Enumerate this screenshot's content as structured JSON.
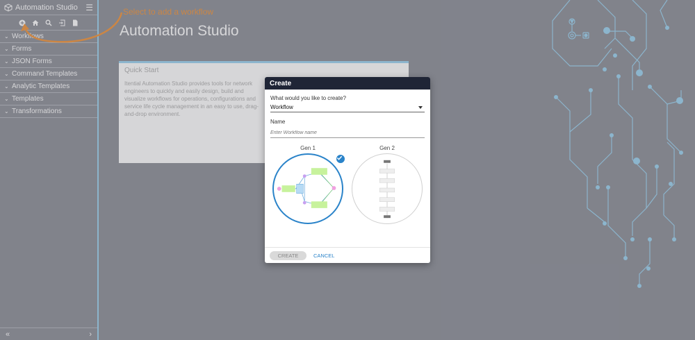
{
  "app": {
    "title": "Automation Studio",
    "logo_icon": "cube-logo-icon",
    "menu_icon": "hamburger-icon"
  },
  "toolbar": {
    "icons": [
      "add-circle-icon",
      "home-icon",
      "search-icon",
      "import-icon",
      "document-icon"
    ]
  },
  "sidebar": {
    "items": [
      {
        "label": "Workflows"
      },
      {
        "label": "Forms"
      },
      {
        "label": "JSON Forms"
      },
      {
        "label": "Command Templates"
      },
      {
        "label": "Analytic Templates"
      },
      {
        "label": "Templates"
      },
      {
        "label": "Transformations"
      }
    ],
    "collapse_label": "«",
    "expand_label": "›"
  },
  "tip": {
    "text": "Select to add a workflow",
    "color": "#f2953a"
  },
  "main": {
    "title": "Automation Studio",
    "quick_start": {
      "title": "Quick Start",
      "text": "Itential Automation Studio provides tools for network engineers to quickly and easily design, build and visualize workflows for operations, configurations and service life cycle management in an easy to use, drag-and-drop environment."
    }
  },
  "modal": {
    "title": "Create",
    "question": "What would you like to create?",
    "selected_type": "Workflow",
    "name_label": "Name",
    "name_placeholder": "Enter Workflow name",
    "gen1_label": "Gen 1",
    "gen2_label": "Gen 2",
    "selected_gen": "Gen 1",
    "create_label": "CREATE",
    "cancel_label": "CANCEL"
  },
  "colors": {
    "accent": "#2a83c9",
    "header": "#1f2536",
    "circuit": "#9cd3f0",
    "background": "#8e9099"
  }
}
